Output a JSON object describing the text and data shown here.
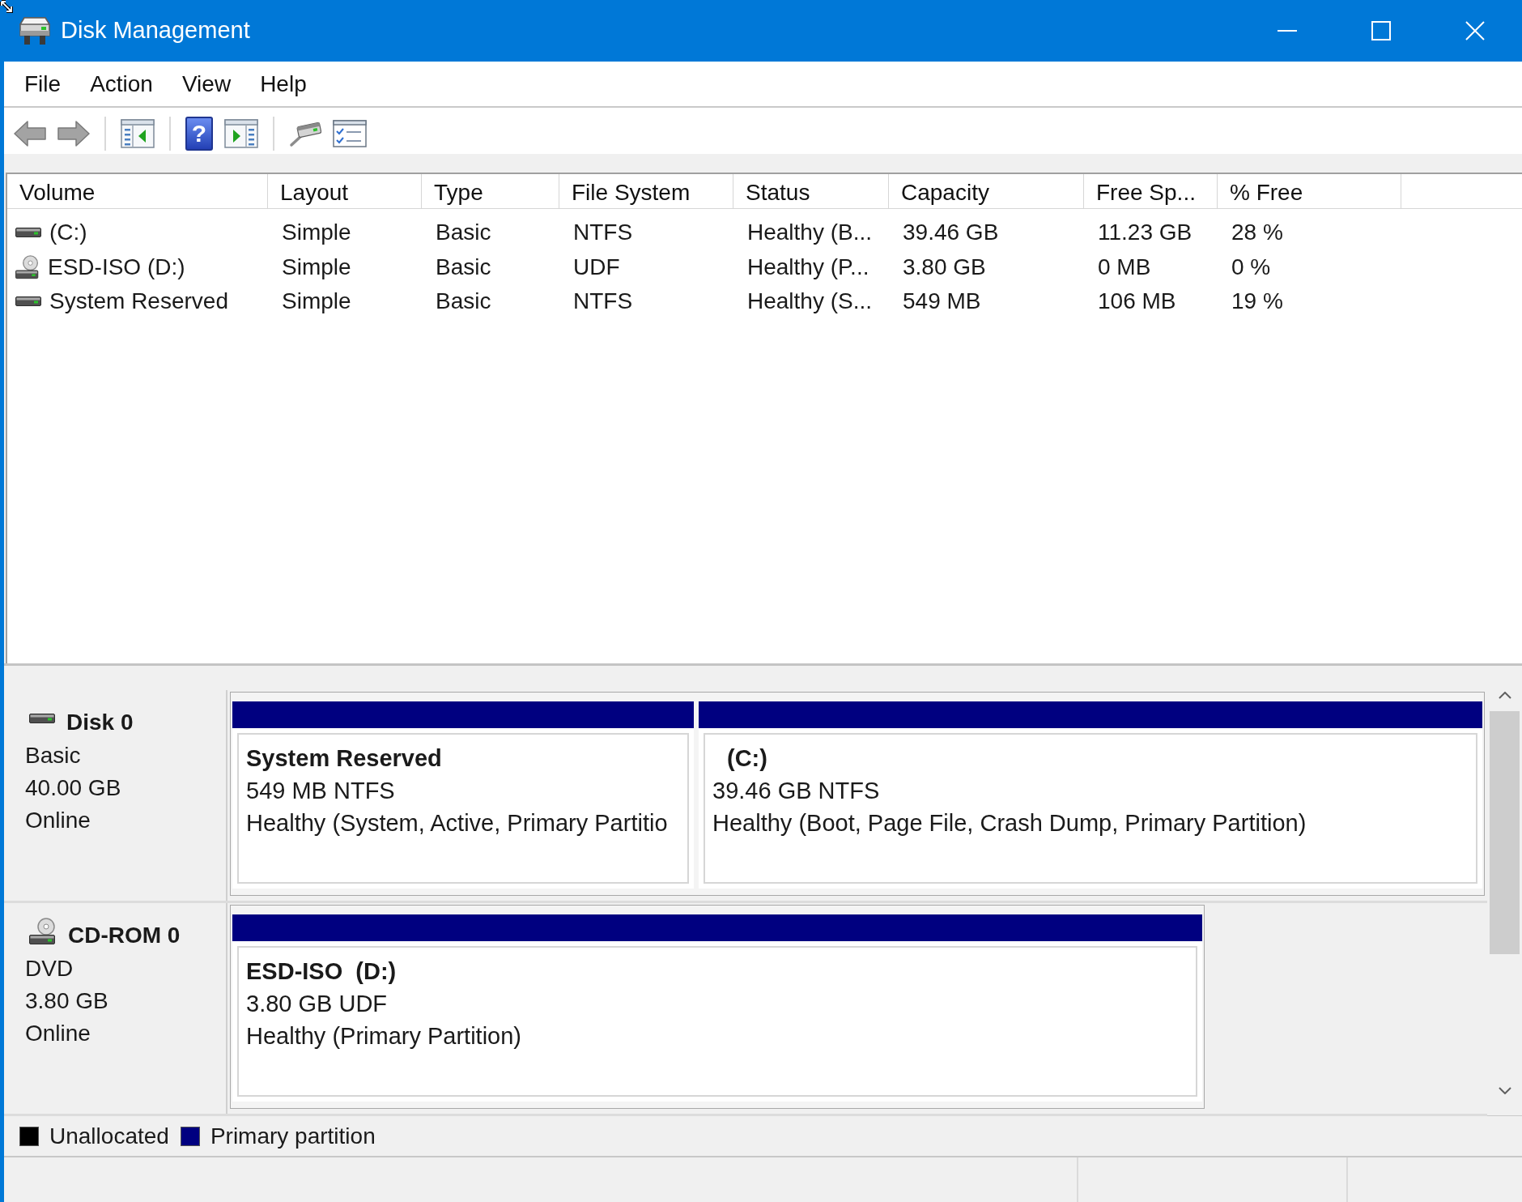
{
  "window": {
    "title": "Disk Management"
  },
  "menu": [
    {
      "label": "File"
    },
    {
      "label": "Action"
    },
    {
      "label": "View"
    },
    {
      "label": "Help"
    }
  ],
  "toolbar": [
    {
      "kind": "back"
    },
    {
      "kind": "forward"
    },
    {
      "kind": "separator"
    },
    {
      "kind": "show_tree"
    },
    {
      "kind": "separator"
    },
    {
      "kind": "help",
      "glyph": "?"
    },
    {
      "kind": "show_action"
    },
    {
      "kind": "separator"
    },
    {
      "kind": "drive"
    },
    {
      "kind": "properties"
    }
  ],
  "volume_table": {
    "columns": [
      "Volume",
      "Layout",
      "Type",
      "File System",
      "Status",
      "Capacity",
      "Free Sp...",
      "% Free"
    ],
    "rows": [
      {
        "kind": "hdd",
        "cells": [
          "(C:)",
          "Simple",
          "Basic",
          "NTFS",
          "Healthy (B...",
          "39.46 GB",
          "11.23 GB",
          "28 %"
        ]
      },
      {
        "kind": "optical",
        "cells": [
          "ESD-ISO (D:)",
          "Simple",
          "Basic",
          "UDF",
          "Healthy (P...",
          "3.80 GB",
          "0 MB",
          "0 %"
        ]
      },
      {
        "kind": "hdd",
        "cells": [
          "System Reserved",
          "Simple",
          "Basic",
          "NTFS",
          "Healthy (S...",
          "549 MB",
          "106 MB",
          "19 %"
        ]
      }
    ]
  },
  "disks": [
    {
      "kind": "hdd",
      "name": "Disk 0",
      "type": "Basic",
      "size": "40.00 GB",
      "status": "Online",
      "partitions": [
        {
          "label": "System Reserved",
          "size_fs": "549 MB NTFS",
          "health": "Healthy (System, Active, Primary Partitio"
        },
        {
          "drive": "(C:)",
          "size_fs": "39.46 GB NTFS",
          "health": "Healthy (Boot, Page File, Crash Dump, Primary Partition)"
        }
      ]
    },
    {
      "kind": "optical",
      "name": "CD-ROM 0",
      "type": "DVD",
      "size": "3.80 GB",
      "status": "Online",
      "partitions": [
        {
          "label": "ESD-ISO",
          "drive": "(D:)",
          "size_fs": "3.80 GB UDF",
          "health": "Healthy (Primary Partition)"
        }
      ]
    }
  ],
  "legend": [
    {
      "label": "Unallocated",
      "color": "#000000"
    },
    {
      "label": "Primary partition",
      "color": "#000080"
    }
  ]
}
